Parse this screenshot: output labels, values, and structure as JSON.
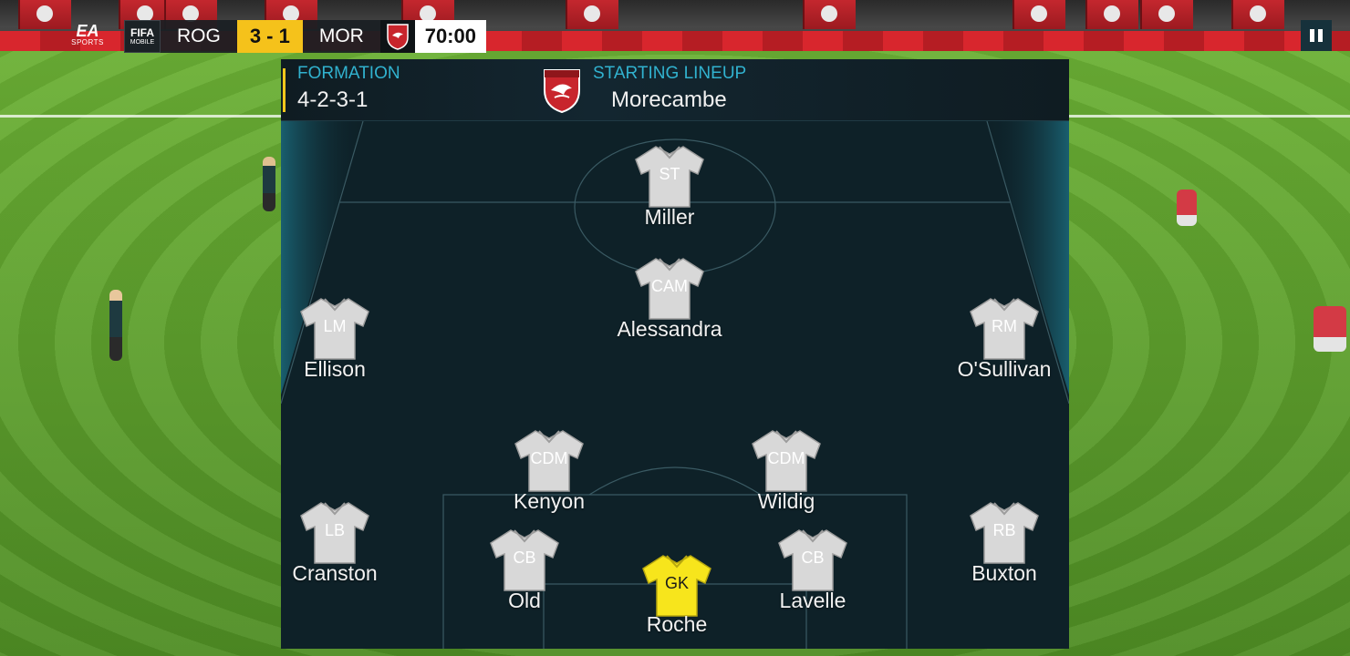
{
  "hud": {
    "ea_logo_text": "EA",
    "ea_logo_sub": "SPORTS",
    "fifa_badge_top": "FIFA",
    "fifa_badge_bottom": "MOBILE",
    "home_team": "ROG",
    "score": "3 - 1",
    "away_team": "MOR",
    "clock": "70:00"
  },
  "lineup": {
    "formation_label": "FORMATION",
    "formation": "4-2-3-1",
    "starting_label": "STARTING LINEUP",
    "team_name": "Morecambe"
  },
  "colors": {
    "accent_cyan": "#31b2cf",
    "score_yellow": "#f5c21b",
    "outfield_shirt": "#d8d8d8",
    "goalkeeper_shirt": "#f7e51c",
    "crest_red": "#c8252c"
  },
  "players": [
    {
      "position": "ST",
      "name": "Miller"
    },
    {
      "position": "CAM",
      "name": "Alessandra"
    },
    {
      "position": "LM",
      "name": "Ellison"
    },
    {
      "position": "RM",
      "name": "O'Sullivan"
    },
    {
      "position": "CDM",
      "name": "Kenyon"
    },
    {
      "position": "CDM",
      "name": "Wildig"
    },
    {
      "position": "LB",
      "name": "Cranston"
    },
    {
      "position": "RB",
      "name": "Buxton"
    },
    {
      "position": "CB",
      "name": "Old"
    },
    {
      "position": "CB",
      "name": "Lavelle"
    },
    {
      "position": "GK",
      "name": "Roche"
    }
  ],
  "icons": {
    "pause": "pause-icon",
    "crest": "morecambe-crest-icon",
    "shirt": "shirt-icon"
  }
}
